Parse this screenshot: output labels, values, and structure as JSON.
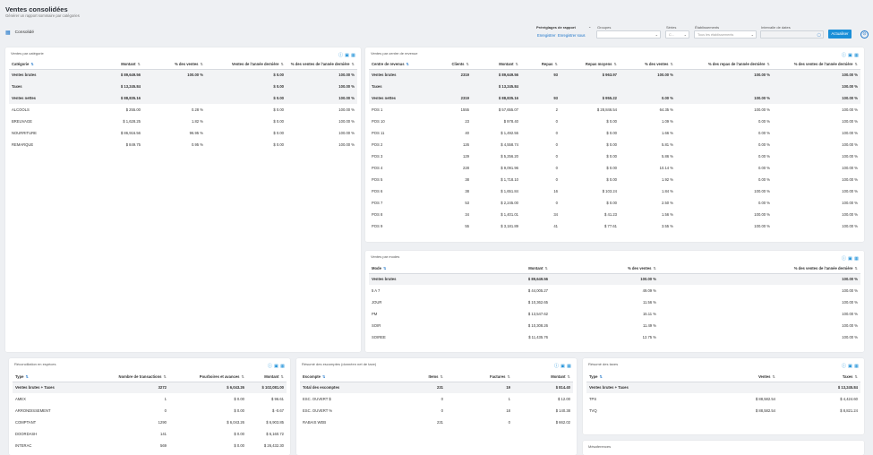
{
  "header": {
    "title": "Ventes consolidées",
    "subtitle": "Générer un rapport sommaire par catégories",
    "consolidated_label": "Consolidé"
  },
  "filters": {
    "presets_label": "Préréglages de rapport",
    "save_label": "Enregistrer",
    "save_as_label": "Enregistrer sous",
    "groups_label": "Groupes",
    "groups_value": "",
    "series_label": "Séries",
    "series_value": "C...",
    "establishments_label": "Établissements",
    "establishments_value": "Tous les établissements",
    "date_range_label": "Intervalle de dates",
    "date_range_value": "",
    "apply_label": "Actualiser"
  },
  "cards": {
    "categories": {
      "title": "Ventes par catégorie",
      "columns": [
        "Catégorie",
        "Montant",
        "% des ventes",
        "Ventes de l'année dernière",
        "% des ventes de l'année dernière"
      ],
      "rows": [
        {
          "bold": true,
          "cells": [
            "Ventes brutes",
            "$ 89,649.56",
            "100.00 %",
            "$ 0.00",
            "100.00 %"
          ]
        },
        {
          "bold": true,
          "cells": [
            "Taxes",
            "$ 13,245.84",
            "",
            "$ 0.00",
            "100.00 %"
          ]
        },
        {
          "bold": true,
          "cells": [
            "Ventes nettes",
            "$ 88,835.16",
            "",
            "$ 0.00",
            "100.00 %"
          ]
        },
        {
          "bold": false,
          "cells": [
            "ALCOOLS",
            "$ 255.00",
            "0.28 %",
            "$ 0.00",
            "100.00 %"
          ]
        },
        {
          "bold": false,
          "cells": [
            "BREUVAGE",
            "$ 1,628.25",
            "1.82 %",
            "$ 0.00",
            "100.00 %"
          ]
        },
        {
          "bold": false,
          "cells": [
            "NOURRITURE",
            "$ 86,916.56",
            "96.95 %",
            "$ 0.00",
            "100.00 %"
          ]
        },
        {
          "bold": false,
          "cells": [
            "REMARQUE",
            "$ 849.75",
            "0.95 %",
            "$ 0.00",
            "100.00 %"
          ]
        }
      ]
    },
    "revenue_centers": {
      "title": "Ventes par centre de revenue",
      "columns": [
        "Centre de revenus",
        "Clients",
        "Montant",
        "Repas",
        "Repas moyens",
        "% des ventes",
        "% des repas de l'année dernière",
        "% des ventes de l'année dernière"
      ],
      "rows": [
        {
          "bold": true,
          "cells": [
            "Ventes brutes",
            "2319",
            "$ 89,649.56",
            "93",
            "$ 963.97",
            "100.00 %",
            "100.00 %",
            "100.00 %"
          ]
        },
        {
          "bold": true,
          "cells": [
            "Taxes",
            "",
            "$ 13,245.84",
            "",
            "",
            "",
            "",
            "100.00 %"
          ]
        },
        {
          "bold": true,
          "cells": [
            "Ventes nettes",
            "2319",
            "$ 88,835.16",
            "93",
            "$ 955.22",
            "0.00 %",
            "100.00 %",
            "100.00 %"
          ]
        },
        {
          "bold": false,
          "cells": [
            "POS 1",
            "1555",
            "$ 57,655.07",
            "2",
            "$ 28,846.54",
            "64.35 %",
            "100.00 %",
            "100.00 %"
          ]
        },
        {
          "bold": false,
          "cells": [
            "POS 10",
            "23",
            "$ 978.40",
            "0",
            "$ 0.00",
            "1.09 %",
            "0.00 %",
            "100.00 %"
          ]
        },
        {
          "bold": false,
          "cells": [
            "POS 11",
            "40",
            "$ 1,492.55",
            "0",
            "$ 0.00",
            "1.66 %",
            "0.00 %",
            "100.00 %"
          ]
        },
        {
          "bold": false,
          "cells": [
            "POS 2",
            "126",
            "$ 4,558.74",
            "0",
            "$ 0.00",
            "5.81 %",
            "0.00 %",
            "100.00 %"
          ]
        },
        {
          "bold": false,
          "cells": [
            "POS 3",
            "129",
            "$ 5,256.20",
            "0",
            "$ 0.00",
            "5.86 %",
            "0.00 %",
            "100.00 %"
          ]
        },
        {
          "bold": false,
          "cells": [
            "POS 4",
            "228",
            "$ 9,091.96",
            "0",
            "$ 0.00",
            "10.14 %",
            "0.00 %",
            "100.00 %"
          ]
        },
        {
          "bold": false,
          "cells": [
            "POS 5",
            "38",
            "$ 1,718.10",
            "0",
            "$ 0.00",
            "1.92 %",
            "0.00 %",
            "100.00 %"
          ]
        },
        {
          "bold": false,
          "cells": [
            "POS 6",
            "38",
            "$ 1,651.84",
            "16",
            "$ 103.24",
            "1.84 %",
            "100.00 %",
            "100.00 %"
          ]
        },
        {
          "bold": false,
          "cells": [
            "POS 7",
            "53",
            "$ 2,245.00",
            "0",
            "$ 0.00",
            "2.50 %",
            "0.00 %",
            "100.00 %"
          ]
        },
        {
          "bold": false,
          "cells": [
            "POS 8",
            "34",
            "$ 1,401.01",
            "34",
            "$ 41.23",
            "1.56 %",
            "100.00 %",
            "100.00 %"
          ]
        },
        {
          "bold": false,
          "cells": [
            "POS 9",
            "55",
            "$ 3,181.89",
            "41",
            "$ 77.61",
            "3.55 %",
            "100.00 %",
            "100.00 %"
          ]
        }
      ]
    },
    "modes": {
      "title": "Ventes par modes",
      "columns": [
        "Mode",
        "Montant",
        "% des ventes",
        "% des ventes de l'année dernière"
      ],
      "rows": [
        {
          "bold": true,
          "cells": [
            "Ventes brutes",
            "$ 89,649.56",
            "100.00 %",
            "100.00 %"
          ]
        },
        {
          "bold": false,
          "cells": [
            "5 A 7",
            "$ 44,005.27",
            "49.09 %",
            "100.00 %"
          ]
        },
        {
          "bold": false,
          "cells": [
            "JOUR",
            "$ 10,362.65",
            "11.56 %",
            "100.00 %"
          ]
        },
        {
          "bold": false,
          "cells": [
            "PM",
            "$ 13,547.62",
            "15.11 %",
            "100.00 %"
          ]
        },
        {
          "bold": false,
          "cells": [
            "SOIR",
            "$ 10,308.26",
            "11.49 %",
            "100.00 %"
          ]
        },
        {
          "bold": false,
          "cells": [
            "SOIREE",
            "$ 11,435.76",
            "12.75 %",
            "100.00 %"
          ]
        }
      ]
    },
    "reconciliation": {
      "title": "Réconciliation en espèces",
      "columns": [
        "Type",
        "Nombre de transactions",
        "Pourboires et avances",
        "Montant"
      ],
      "rows": [
        {
          "bold": true,
          "cells": [
            "Ventes brutes + Taxes",
            "3272",
            "$ 6,043.26",
            "$ 102,081.00"
          ]
        },
        {
          "bold": false,
          "cells": [
            "AMEX",
            "1",
            "$ 0.00",
            "$ 96.61"
          ]
        },
        {
          "bold": false,
          "cells": [
            "ARRONDISSEMENT",
            "0",
            "$ 0.00",
            "$ -0.67"
          ]
        },
        {
          "bold": false,
          "cells": [
            "COMPTANT",
            "1290",
            "$ 6,043.26",
            "$ 6,903.85"
          ]
        },
        {
          "bold": false,
          "cells": [
            "DOORDASH",
            "141",
            "$ 0.00",
            "$ 6,160.72"
          ]
        },
        {
          "bold": false,
          "cells": [
            "INTERAC",
            "569",
            "$ 0.00",
            "$ 26,432.30"
          ]
        }
      ]
    },
    "discounts": {
      "title": "Résumé des escomptes (donnéen net de taxe)",
      "columns": [
        "Escompte",
        "Items",
        "Factures",
        "Montant"
      ],
      "rows": [
        {
          "bold": true,
          "cells": [
            "Total des escomptes",
            "231",
            "19",
            "$ 814.40"
          ]
        },
        {
          "bold": false,
          "cells": [
            "ESC. OUVERT $",
            "0",
            "1",
            "$ 12.00"
          ]
        },
        {
          "bold": false,
          "cells": [
            "ESC. OUVERT %",
            "0",
            "18",
            "$ 140.38"
          ]
        },
        {
          "bold": false,
          "cells": [
            "RABAIS WEB",
            "231",
            "0",
            "$ 662.02"
          ]
        }
      ]
    },
    "taxes": {
      "title": "Résumé des taxes",
      "columns": [
        "Type",
        "Ventes",
        "Taxes"
      ],
      "rows": [
        {
          "bold": true,
          "cells": [
            "Ventes brutes + Taxes",
            "",
            "$ 13,245.84"
          ]
        },
        {
          "bold": false,
          "cells": [
            "TPS",
            "$ 88,582.54",
            "$ 4,424.60"
          ]
        },
        {
          "bold": false,
          "cells": [
            "TVQ",
            "$ 88,582.54",
            "$ 8,821.24"
          ]
        }
      ]
    },
    "transfers": {
      "title": "Mésaferences"
    }
  }
}
